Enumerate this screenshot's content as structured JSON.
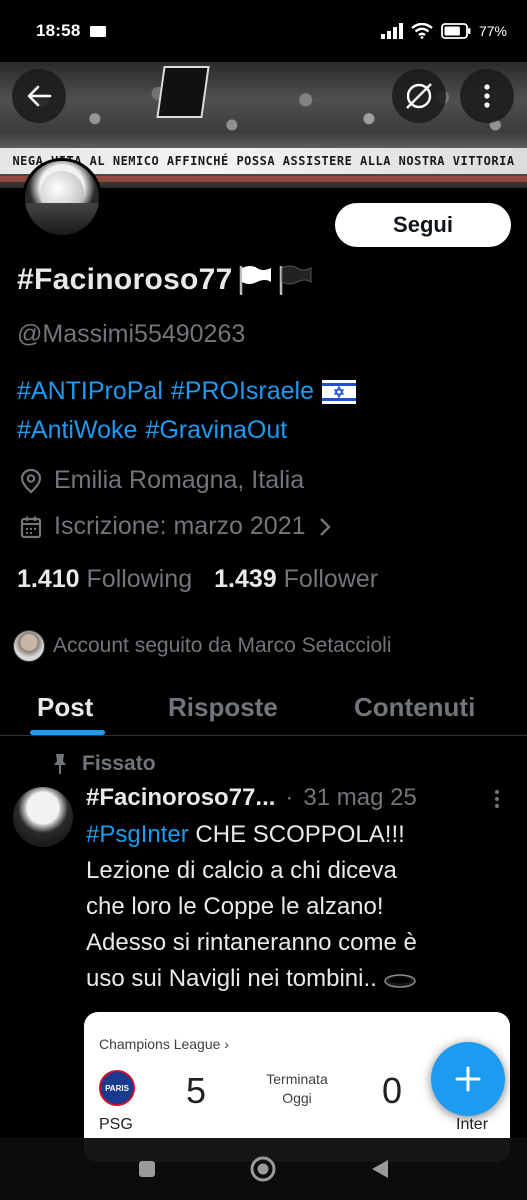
{
  "status_bar": {
    "time": "18:58",
    "battery_percent": "77%",
    "battery_level": 0.77
  },
  "banner": {
    "stadium_text": "NEGA VITA AL NEMICO AFFINCHÉ POSSA ASSISTERE ALLA NOSTRA VITTORIA"
  },
  "profile": {
    "follow_label": "Segui",
    "display_name": "#Facinoroso77",
    "name_emojis": [
      "white-flag-icon",
      "black-flag-icon"
    ],
    "handle": "@Massimi55490263",
    "bio_line1_tags": [
      "#ANTIProPal",
      "#PROIsraele"
    ],
    "bio_line2_tags": [
      "#AntiWoke",
      "#GravinaOut"
    ],
    "location": "Emilia Romagna, Italia",
    "joined": "Iscrizione: marzo 2021",
    "following_count": "1.410",
    "following_label": "Following",
    "followers_count": "1.439",
    "followers_label": "Follower",
    "followed_by": "Account seguito da Marco Setaccioli"
  },
  "tabs": [
    {
      "label": "Post",
      "active": true
    },
    {
      "label": "Risposte",
      "active": false
    },
    {
      "label": "Contenuti",
      "active": false
    }
  ],
  "tweet": {
    "pinned_label": "Fissato",
    "author": "#Facinoroso77...",
    "separator": "·",
    "date": "31 mag 25",
    "hashtag": "#PsgInter",
    "line1_rest": " CHE SCOPPOLA!!!",
    "line2": "Lezione di calcio a chi diceva",
    "line3": "che loro le Coppe le alzano!",
    "line4": "Adesso si rintaneranno come è",
    "line5": "uso sui Navigli nei tombini.."
  },
  "match_card": {
    "competition": "Champions League ›",
    "home_team": "PSG",
    "away_team": "Inter",
    "home_score": "5",
    "away_score": "0",
    "status_line1": "Terminata",
    "status_line2": "Oggi",
    "more": "⋮"
  },
  "colors": {
    "accent": "#1d9bf0",
    "background": "#000000",
    "muted_text": "#71767b",
    "primary_text": "#e7e9ea"
  }
}
